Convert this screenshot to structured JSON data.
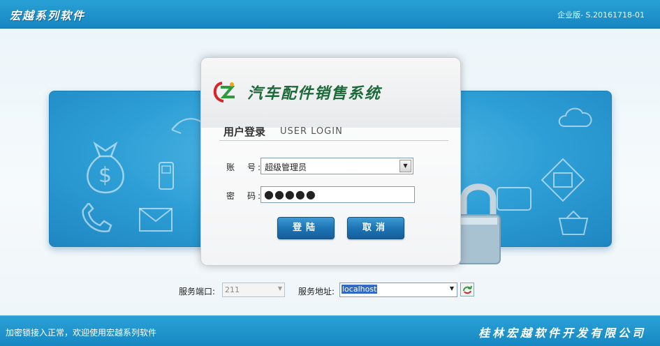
{
  "header": {
    "brand": "宏越系列软件",
    "version": "企业版- S.20161718-01"
  },
  "login": {
    "system_title": "汽车配件销售系统",
    "heading_cn": "用户登录",
    "heading_en": "USER LOGIN",
    "account_label": "账　号:",
    "account_value": "超级管理员",
    "password_label": "密　码:",
    "password_value": "●●●●●",
    "login_button": "登陆",
    "cancel_button": "取消"
  },
  "server": {
    "port_label": "服务端口:",
    "port_value": "211",
    "address_label": "服务地址:",
    "address_value": "localhost"
  },
  "footer": {
    "status": "加密锁接入正常，欢迎使用宏越系列软件",
    "company": "桂林宏越软件开发有限公司"
  },
  "colors": {
    "accent": "#1e8ac6",
    "button": "#1e74b5",
    "selection": "#316ac5"
  }
}
